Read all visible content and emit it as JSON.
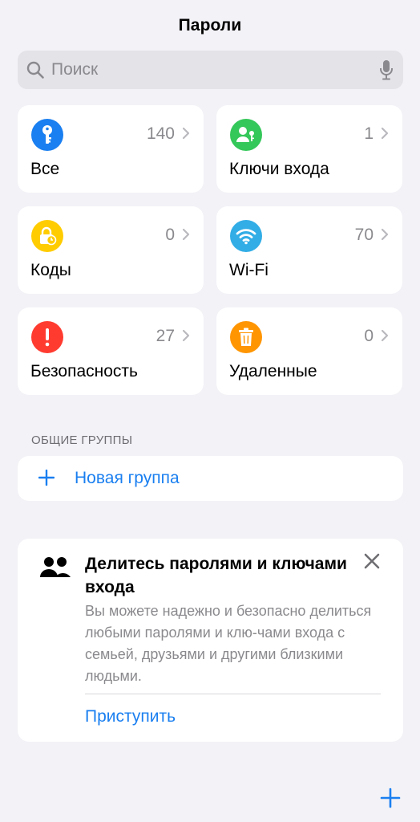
{
  "header": {
    "title": "Пароли"
  },
  "search": {
    "placeholder": "Поиск",
    "icon": "search-icon",
    "mic_icon": "microphone-icon"
  },
  "categories": [
    {
      "label": "Все",
      "count": "140",
      "icon": "key-icon",
      "color": "#1a7ff0"
    },
    {
      "label": "Ключи входа",
      "count": "1",
      "icon": "passkey-person-icon",
      "color": "#34c759"
    },
    {
      "label": "Коды",
      "count": "0",
      "icon": "lock-clock-icon",
      "color": "#ffcc00"
    },
    {
      "label": "Wi-Fi",
      "count": "70",
      "icon": "wifi-icon",
      "color": "#32ade6"
    },
    {
      "label": "Безопасность",
      "count": "27",
      "icon": "exclamation-icon",
      "color": "#ff3b30"
    },
    {
      "label": "Удаленные",
      "count": "0",
      "icon": "trash-icon",
      "color": "#ff9500"
    }
  ],
  "shared_groups": {
    "section_label": "ОБЩИЕ ГРУППЫ",
    "new_group_label": "Новая группа"
  },
  "share_card": {
    "title": "Делитесь паролями и ключами входа",
    "body": "Вы можете надежно и безопасно делиться любыми паролями и клю-чами входа с семьей, друзьями и другими близкими людьми.",
    "action_label": "Приступить"
  },
  "colors": {
    "accent": "#1a7ff0",
    "background": "#f2f2f7",
    "secondary_text": "#8a8a8e"
  }
}
